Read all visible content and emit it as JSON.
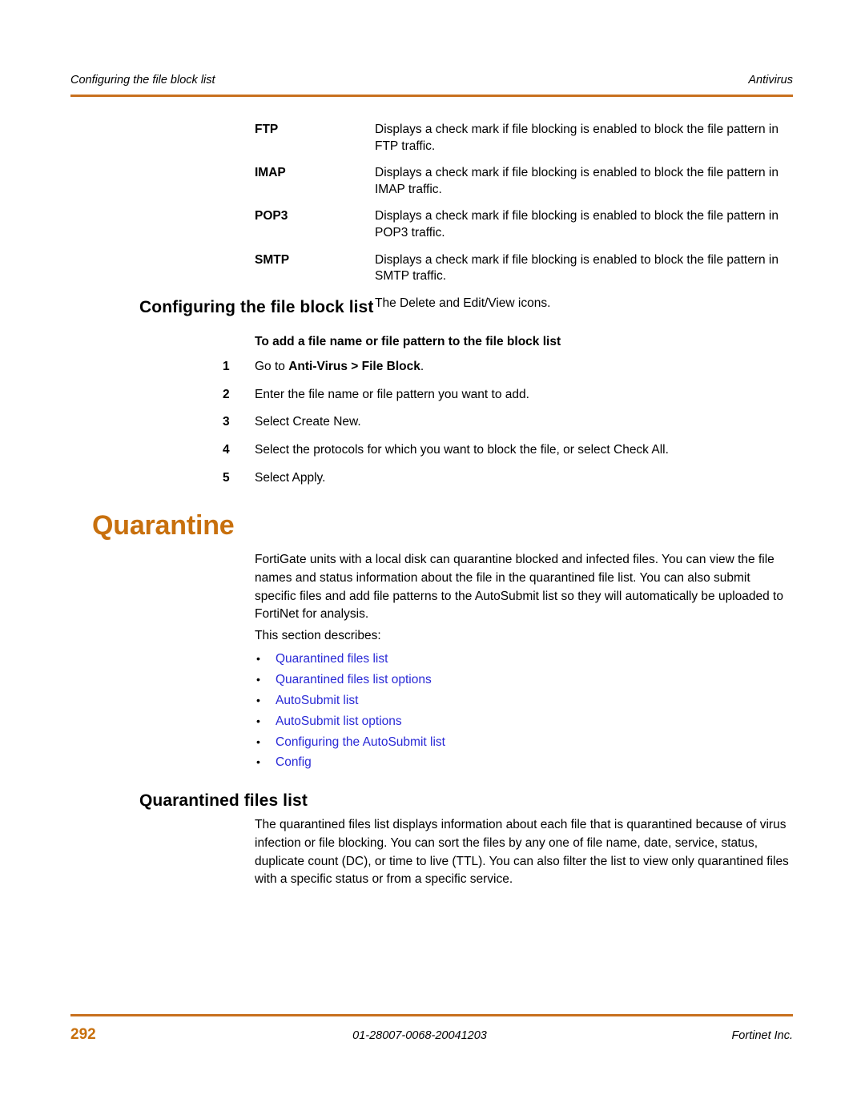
{
  "header": {
    "left_text": "Configuring the file block list",
    "right_text": "Antivirus",
    "rule_color": "#C8701E"
  },
  "definition_table": {
    "rows": [
      {
        "term": "FTP",
        "description": "Displays a check mark if file blocking is enabled to block the file pattern in FTP traffic."
      },
      {
        "term": "IMAP",
        "description": "Displays a check mark if file blocking is enabled to block the file pattern in IMAP traffic."
      },
      {
        "term": "POP3",
        "description": "Displays a check mark if file blocking is enabled to block the file pattern in POP3 traffic."
      },
      {
        "term": "SMTP",
        "description": "Displays a check mark if file blocking is enabled to block the file pattern in SMTP traffic."
      },
      {
        "term": "",
        "description": "The Delete and Edit/View icons."
      }
    ]
  },
  "section_file_block": {
    "heading": "Configuring the file block list",
    "procedure_title": "To add a file name or file pattern to the file block list",
    "steps": [
      {
        "num": "1",
        "text_before": "Go to ",
        "bold": "Anti-Virus > File Block",
        "text_after": "."
      },
      {
        "num": "2",
        "text_before": "Enter the file name or file pattern you want to add.",
        "bold": "",
        "text_after": ""
      },
      {
        "num": "3",
        "text_before": "Select Create New.",
        "bold": "",
        "text_after": ""
      },
      {
        "num": "4",
        "text_before": "Select the protocols for which you want to block the file, or select Check All.",
        "bold": "",
        "text_after": ""
      },
      {
        "num": "5",
        "text_before": "Select Apply.",
        "bold": "",
        "text_after": ""
      }
    ]
  },
  "chapter": {
    "title": "Quarantine",
    "color": "#C8700D",
    "intro_paragraph": "FortiGate units with a local disk can quarantine blocked and infected files. You can view the file names and status information about the file in the quarantined file list. You can also submit specific files and add file patterns to the AutoSubmit list so they will automatically be uploaded to FortiNet for analysis.",
    "describes_lead": "This section describes:",
    "link_color": "#2929D6",
    "links": [
      "Quarantined files list",
      "Quarantined files list options",
      "AutoSubmit list",
      "AutoSubmit list options",
      "Configuring the AutoSubmit list",
      "Config"
    ]
  },
  "section_quarantined_files": {
    "heading": "Quarantined files list",
    "paragraph": "The quarantined files list displays information about each file that is quarantined because of virus infection or file blocking. You can sort the files by any one of file name, date, service, status, duplicate count (DC), or time to live (TTL). You can also filter the list to view only quarantined files with a specific status or from a specific service."
  },
  "footer": {
    "page_number": "292",
    "document_id": "01-28007-0068-20041203",
    "company": "Fortinet Inc."
  }
}
